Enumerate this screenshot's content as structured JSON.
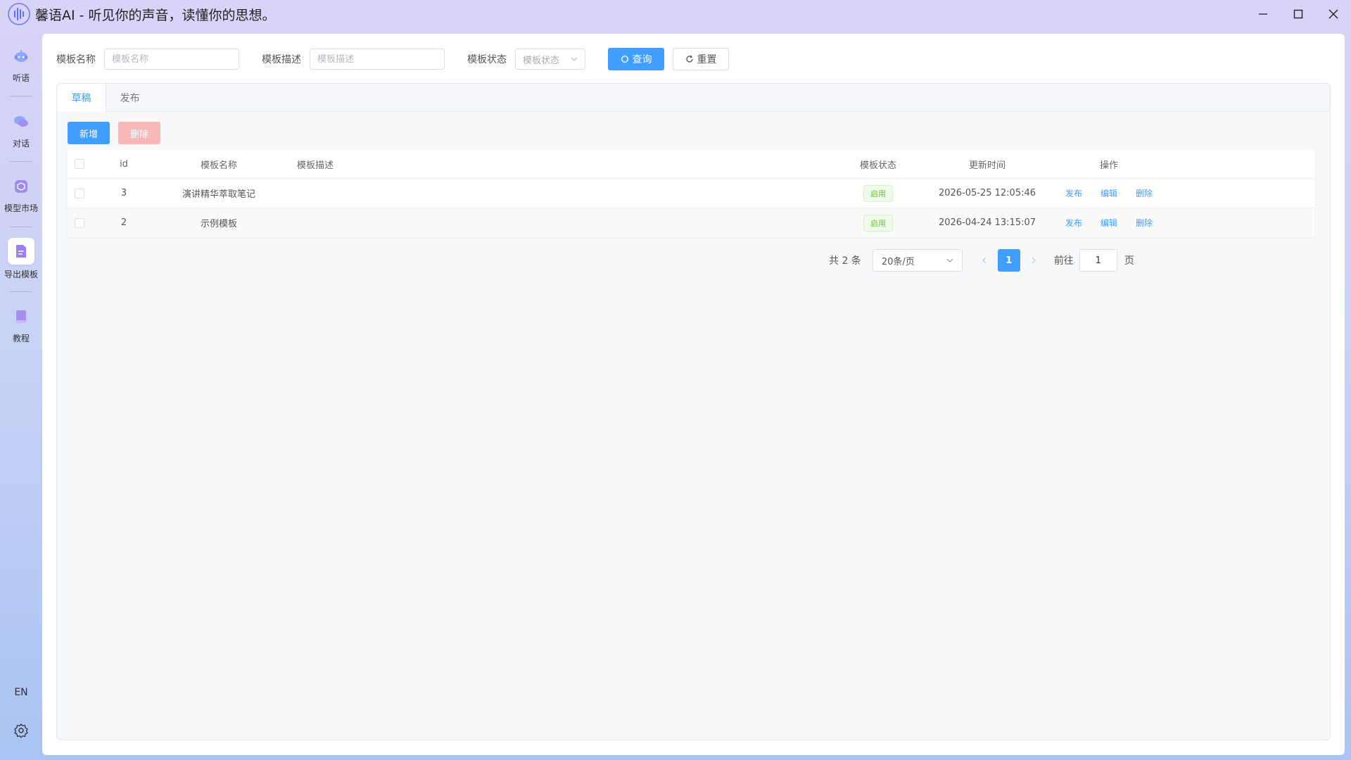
{
  "app": {
    "title": "馨语AI - 听见你的声音，读懂你的思想。"
  },
  "sidebar": {
    "items": [
      {
        "label": "听语",
        "icon": "robot-icon"
      },
      {
        "label": "对话",
        "icon": "chat-bubbles-icon"
      },
      {
        "label": "模型市场",
        "icon": "cube-icon"
      },
      {
        "label": "导出模板",
        "icon": "document-icon"
      },
      {
        "label": "教程",
        "icon": "book-icon"
      }
    ],
    "language": "EN"
  },
  "search": {
    "name_label": "模板名称",
    "name_placeholder": "模板名称",
    "desc_label": "模板描述",
    "desc_placeholder": "模板描述",
    "status_label": "模板状态",
    "status_placeholder": "模板状态",
    "query_label": "查询",
    "reset_label": "重置"
  },
  "tabs": [
    {
      "label": "草稿",
      "active": true
    },
    {
      "label": "发布",
      "active": false
    }
  ],
  "toolbar": {
    "add_label": "新增",
    "delete_label": "删除"
  },
  "table": {
    "headers": {
      "id": "id",
      "name": "模板名称",
      "desc": "模板描述",
      "status": "模板状态",
      "updated": "更新时间",
      "ops": "操作"
    },
    "rows": [
      {
        "id": "3",
        "name": "演讲精华萃取笔记",
        "desc": "",
        "status": "启用",
        "updated": "2026-05-25 12:05:46",
        "ops": [
          "发布",
          "编辑",
          "删除"
        ]
      },
      {
        "id": "2",
        "name": "示例模板",
        "desc": "",
        "status": "启用",
        "updated": "2026-04-24 13:15:07",
        "ops": [
          "发布",
          "编辑",
          "删除"
        ]
      }
    ]
  },
  "pagination": {
    "total": "共 2 条",
    "page_size": "20条/页",
    "current_page": "1",
    "goto_label": "前往",
    "goto_value": "1",
    "page_suffix": "页"
  },
  "colors": {
    "primary": "#409eff",
    "danger_disabled": "#f9b8b8",
    "success_tag": "#67c23a"
  }
}
